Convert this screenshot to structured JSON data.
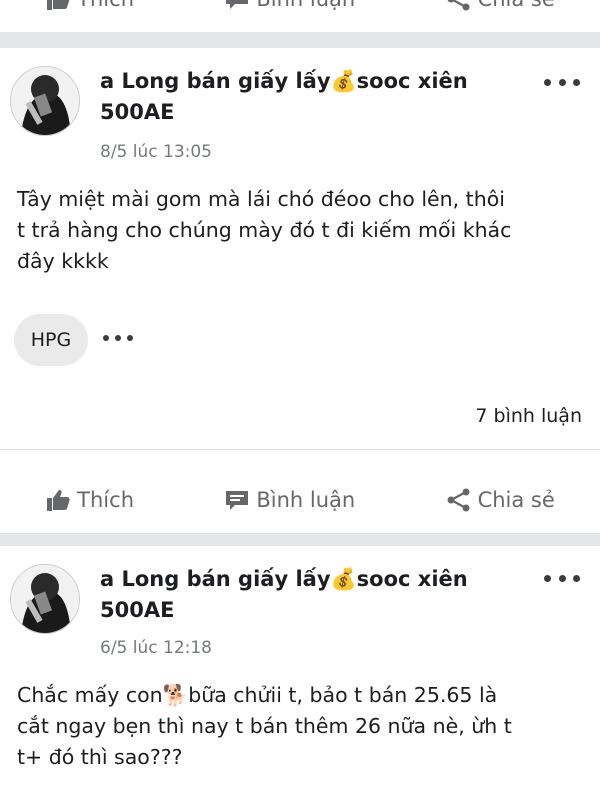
{
  "actions": {
    "like_label": "Thích",
    "comment_label": "Bình luận",
    "share_label": "Chia sẻ"
  },
  "posts": [
    {
      "author_name": "a Long bán giấy lấy",
      "author_emoji": "💰",
      "author_name_suffix": "sooc xiên",
      "author_name_line2": "500AE",
      "timestamp": "8/5 lúc 13:05",
      "text_line1": "Tây miệt mài gom mà lái chó đéoo cho lên, thôi",
      "text_line2": "t trả hàng cho chúng mày đó t đi kiếm mối khác",
      "text_line3": "đây kkkk",
      "tag": "HPG",
      "comment_count": "7 bình luận"
    },
    {
      "author_name": "a Long bán giấy lấy",
      "author_emoji": "💰",
      "author_name_suffix": "sooc xiên",
      "author_name_line2": "500AE",
      "timestamp": "6/5 lúc 12:18",
      "text_line1_a": "Chắc mấy con",
      "text_emoji": "🐕",
      "text_line1_b": "bữa chửii t, bảo t bán 25.65 là",
      "text_line2": "cắt ngay bẹn thì nay t bán thêm 26 nữa nè, ừh t",
      "text_line3": "t+ đó thì sao???"
    }
  ]
}
